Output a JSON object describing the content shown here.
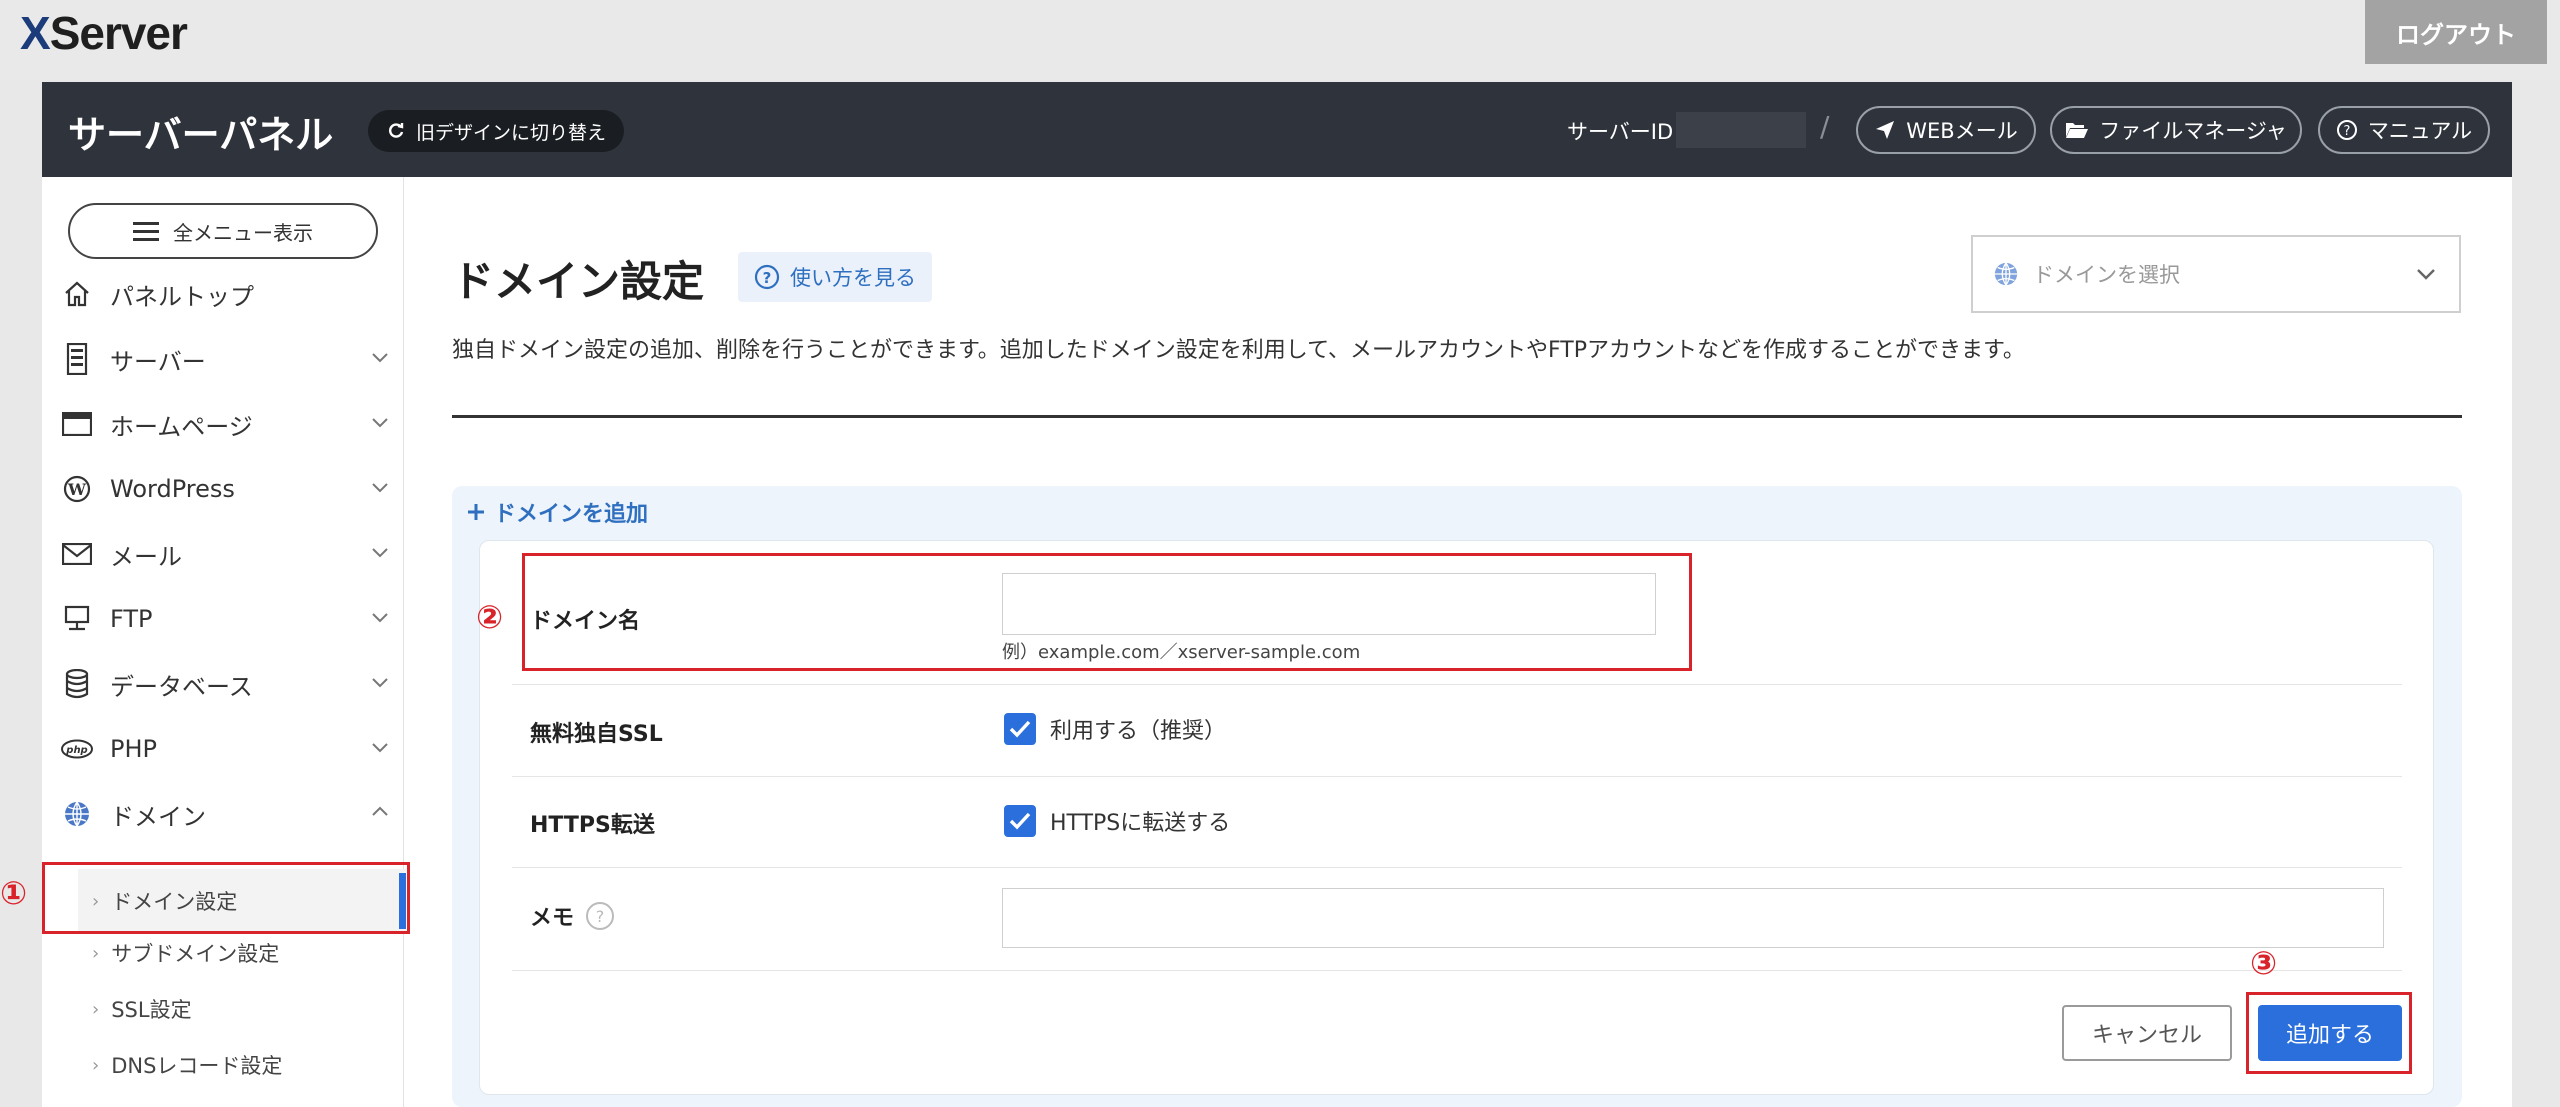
{
  "topbar": {
    "logo_x": "X",
    "logo_rest": "Server",
    "logout_label": "ログアウト"
  },
  "header": {
    "panel_title": "サーバーパネル",
    "switch_label": "旧デザインに切り替え",
    "server_id_label": "サーバーID",
    "separator": "/",
    "webmail_label": "WEBメール",
    "filemanager_label": "ファイルマネージャ",
    "manual_label": "マニュアル"
  },
  "sidebar": {
    "all_menu_label": "全メニュー表示",
    "items": [
      {
        "label": "パネルトップ",
        "icon": "home-icon"
      },
      {
        "label": "サーバー",
        "icon": "server-icon"
      },
      {
        "label": "ホームページ",
        "icon": "browser-icon"
      },
      {
        "label": "WordPress",
        "icon": "wordpress-icon"
      },
      {
        "label": "メール",
        "icon": "mail-icon"
      },
      {
        "label": "FTP",
        "icon": "ftp-icon"
      },
      {
        "label": "データベース",
        "icon": "database-icon"
      },
      {
        "label": "PHP",
        "icon": "php-icon"
      },
      {
        "label": "ドメイン",
        "icon": "globe-icon"
      }
    ],
    "submenu": [
      {
        "label": "ドメイン設定",
        "active": true
      },
      {
        "label": "サブドメイン設定"
      },
      {
        "label": "SSL設定"
      },
      {
        "label": "DNSレコード設定"
      }
    ]
  },
  "main": {
    "title": "ドメイン設定",
    "howto_label": "使い方を見る",
    "domain_select_placeholder": "ドメインを選択",
    "description": "独自ドメイン設定の追加、削除を行うことができます。追加したドメイン設定を利用して、メールアカウントやFTPアカウントなどを作成することができます。",
    "add_heading": "ドメインを追加",
    "form": {
      "domain_label": "ドメイン名",
      "domain_value": "",
      "domain_hint": "例）example.com／xserver-sample.com",
      "ssl_label": "無料独自SSL",
      "ssl_checkbox_label": "利用する（推奨）",
      "ssl_checked": true,
      "https_label": "HTTPS転送",
      "https_checkbox_label": "HTTPSに転送する",
      "https_checked": true,
      "memo_label": "メモ",
      "memo_value": "",
      "cancel_label": "キャンセル",
      "submit_label": "追加する"
    }
  },
  "annotations": {
    "m1": "①",
    "m2": "②",
    "m3": "③",
    "color": "#d9232b"
  },
  "colors": {
    "accent": "#2a6fdb",
    "header_bg": "#2f343c",
    "link": "#2f6fc0"
  }
}
